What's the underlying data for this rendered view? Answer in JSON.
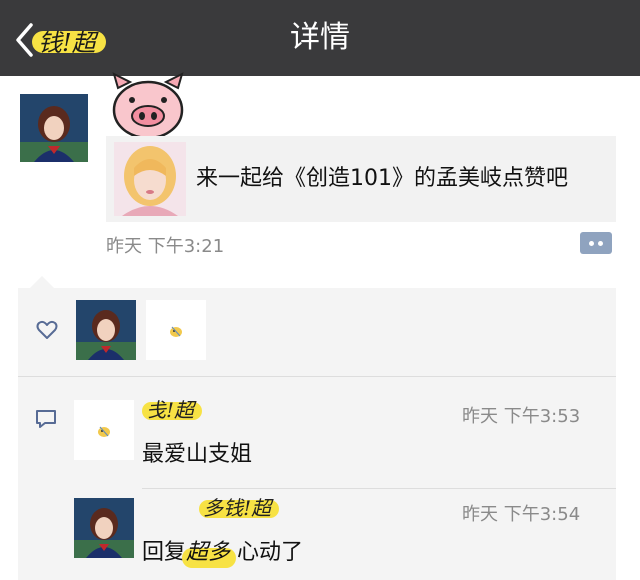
{
  "nav": {
    "back_label": "钱!超",
    "title": "详情"
  },
  "post": {
    "card_text": "来一起给《创造101》的孟美岐点赞吧",
    "time": "昨天 下午3:21"
  },
  "comments": [
    {
      "name": "戋!超",
      "time": "昨天 下午3:53",
      "text": "最爱山支姐"
    },
    {
      "name": "多钱!超",
      "time": "昨天 下午3:54",
      "reply_prefix": "回复",
      "reply_name": "超多",
      "text": "心动了"
    }
  ],
  "colors": {
    "navbar": "#3a3a3c",
    "highlight": "#f7e244",
    "panel": "#f4f4f4",
    "more_button": "#8fa3bf"
  },
  "icons": {
    "back": "chevron-left-icon",
    "more": "more-dots-icon",
    "like": "heart-icon",
    "comment": "comment-icon",
    "sticker": "pig-face-icon"
  }
}
